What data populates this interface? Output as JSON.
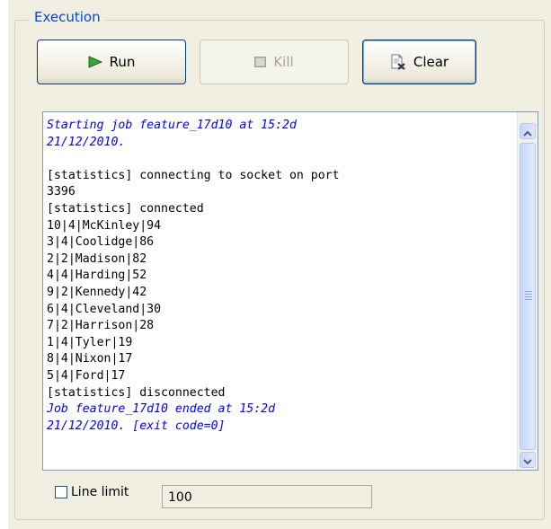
{
  "group": {
    "title": "Execution"
  },
  "buttons": {
    "run": {
      "label": "Run",
      "icon": "play-icon",
      "enabled": true
    },
    "kill": {
      "label": "Kill",
      "icon": "stop-icon",
      "enabled": false
    },
    "clear": {
      "label": "Clear",
      "icon": "clear-icon",
      "enabled": true
    }
  },
  "console": {
    "lines": [
      {
        "text": "Starting job feature_17d10 at 15:2d",
        "style": "blue"
      },
      {
        "text": "21/12/2010.",
        "style": "blue"
      },
      {
        "text": "",
        "style": "normal"
      },
      {
        "text": "[statistics] connecting to socket on port",
        "style": "normal"
      },
      {
        "text": "3396",
        "style": "normal"
      },
      {
        "text": "[statistics] connected",
        "style": "normal"
      },
      {
        "text": "10|4|McKinley|94",
        "style": "normal"
      },
      {
        "text": "3|4|Coolidge|86",
        "style": "normal"
      },
      {
        "text": "2|2|Madison|82",
        "style": "normal"
      },
      {
        "text": "4|4|Harding|52",
        "style": "normal"
      },
      {
        "text": "9|2|Kennedy|42",
        "style": "normal"
      },
      {
        "text": "6|4|Cleveland|30",
        "style": "normal"
      },
      {
        "text": "7|2|Harrison|28",
        "style": "normal"
      },
      {
        "text": "1|4|Tyler|19",
        "style": "normal"
      },
      {
        "text": "8|4|Nixon|17",
        "style": "normal"
      },
      {
        "text": "5|4|Ford|17",
        "style": "normal"
      },
      {
        "text": "[statistics] disconnected",
        "style": "normal"
      },
      {
        "text": "Job feature_17d10 ended at 15:2d",
        "style": "blue"
      },
      {
        "text": "21/12/2010. [exit code=0]",
        "style": "blue"
      }
    ]
  },
  "line_limit": {
    "label": "Line limit",
    "checked": false,
    "value": "100"
  },
  "colors": {
    "accent": "#0046d5",
    "log_highlight": "#0000ff",
    "panel_bg": "#f1efe2"
  }
}
